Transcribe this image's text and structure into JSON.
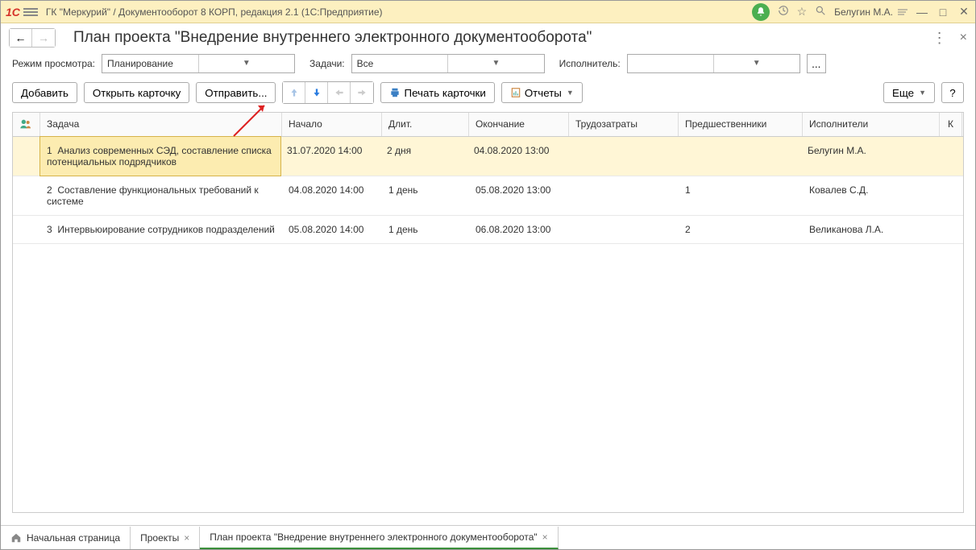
{
  "titlebar": {
    "app_title": "ГК \"Меркурий\" / Документооборот 8 КОРП, редакция 2.1  (1С:Предприятие)",
    "user_name": "Белугин М.А."
  },
  "page": {
    "title": "План проекта \"Внедрение внутреннего электронного документооборота\""
  },
  "filters": {
    "mode_label": "Режим просмотра:",
    "mode_value": "Планирование",
    "tasks_label": "Задачи:",
    "tasks_value": "Все",
    "user_label": "Исполнитель:",
    "user_value": ""
  },
  "toolbar": {
    "add": "Добавить",
    "open_card": "Открыть карточку",
    "send": "Отправить...",
    "print_card": "Печать карточки",
    "reports": "Отчеты",
    "more": "Еще",
    "help": "?"
  },
  "grid": {
    "headers": {
      "task": "Задача",
      "start": "Начало",
      "duration": "Длит.",
      "end": "Окончание",
      "effort": "Трудозатраты",
      "predecessors": "Предшественники",
      "executors": "Исполнители",
      "k": "К"
    },
    "rows": [
      {
        "num": "1",
        "task": "Анализ современных СЭД, составление списка потенциальных подрядчиков",
        "start": "31.07.2020 14:00",
        "duration": "2 дня",
        "end": "04.08.2020 13:00",
        "effort": "",
        "predecessors": "",
        "executors": "Белугин М.А.",
        "selected": true
      },
      {
        "num": "2",
        "task": "Составление функциональных требований к системе",
        "start": "04.08.2020 14:00",
        "duration": "1 день",
        "end": "05.08.2020 13:00",
        "effort": "",
        "predecessors": "1",
        "executors": "Ковалев С.Д.",
        "selected": false
      },
      {
        "num": "3",
        "task": "Интервьюирование сотрудников подразделений",
        "start": "05.08.2020 14:00",
        "duration": "1 день",
        "end": "06.08.2020 13:00",
        "effort": "",
        "predecessors": "2",
        "executors": "Великанова Л.А.",
        "selected": false
      }
    ]
  },
  "taskbar": {
    "home": "Начальная страница",
    "tabs": [
      {
        "label": "Проекты",
        "closable": true,
        "active": false
      },
      {
        "label": "План проекта \"Внедрение внутреннего электронного документооборота\"",
        "closable": true,
        "active": true
      }
    ]
  }
}
